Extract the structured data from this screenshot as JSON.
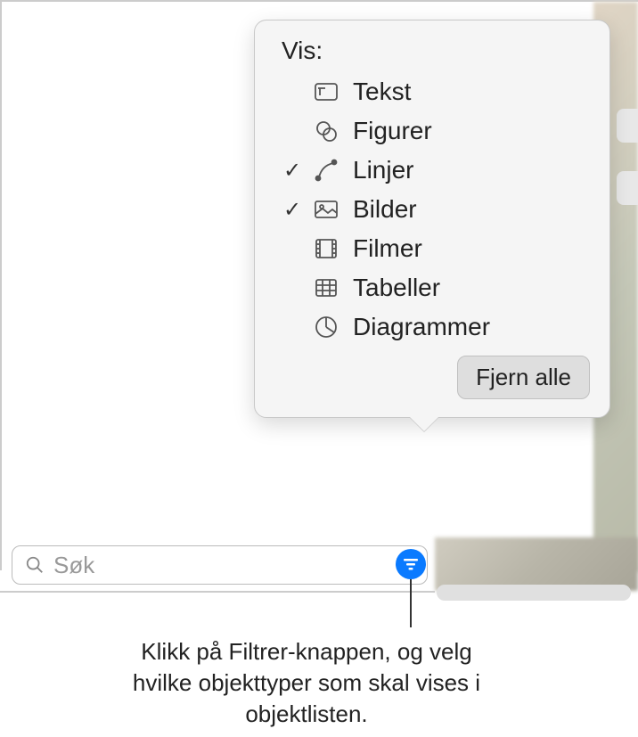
{
  "popover": {
    "title": "Vis:",
    "items": [
      {
        "label": "Tekst",
        "checked": false,
        "icon": "text"
      },
      {
        "label": "Figurer",
        "checked": false,
        "icon": "shapes"
      },
      {
        "label": "Linjer",
        "checked": true,
        "icon": "line"
      },
      {
        "label": "Bilder",
        "checked": true,
        "icon": "image"
      },
      {
        "label": "Filmer",
        "checked": false,
        "icon": "film"
      },
      {
        "label": "Tabeller",
        "checked": false,
        "icon": "table"
      },
      {
        "label": "Diagrammer",
        "checked": false,
        "icon": "chart"
      }
    ],
    "clear_all": "Fjern alle"
  },
  "search": {
    "placeholder": "Søk"
  },
  "annotation": {
    "text": "Klikk på Filtrer-knappen, og velg hvilke objekttyper som skal vises i objektlisten."
  }
}
